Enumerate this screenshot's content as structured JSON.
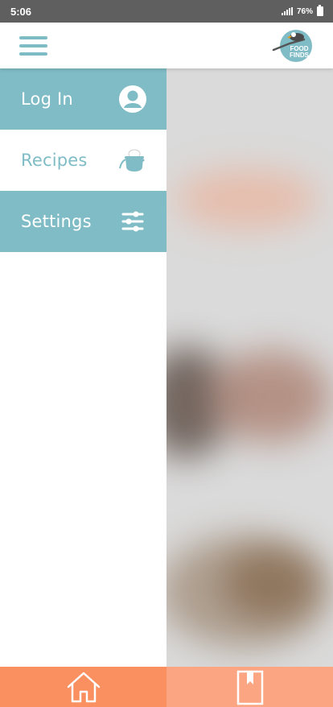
{
  "status_bar": {
    "time": "5:06",
    "battery": "76%"
  },
  "header": {
    "logo_text_1": "FOOD",
    "logo_text_2": "FINDS"
  },
  "drawer": {
    "items": [
      {
        "label": "Log In",
        "icon": "user-icon"
      },
      {
        "label": "Recipes",
        "icon": "pot-icon"
      },
      {
        "label": "Settings",
        "icon": "sliders-icon"
      }
    ]
  },
  "bottom_nav": {
    "items": [
      {
        "icon": "home-icon"
      },
      {
        "icon": "bookmark-icon"
      }
    ]
  },
  "colors": {
    "accent_teal": "#7fbcc5",
    "nav_home": "#fa8f60",
    "nav_saved": "#fba582",
    "status_bar": "#5f5f5f"
  }
}
